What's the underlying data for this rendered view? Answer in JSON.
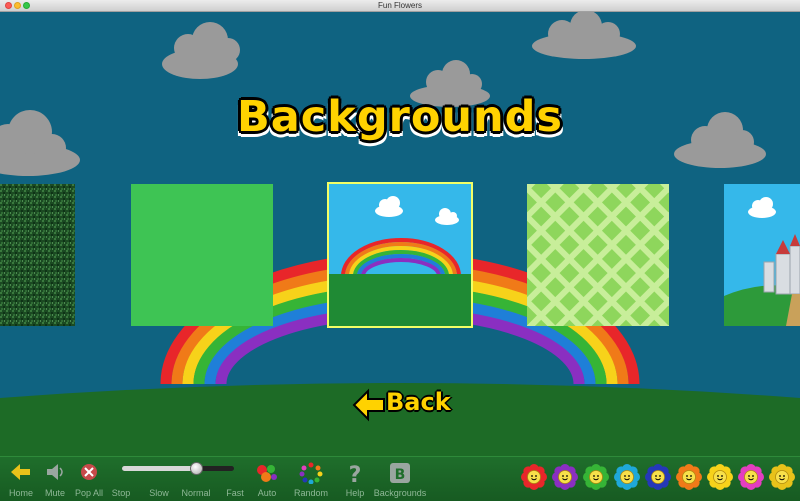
{
  "window": {
    "title": "Fun Flowers"
  },
  "screen": {
    "heading": "Backgrounds",
    "back_label": "Back"
  },
  "backgrounds": [
    {
      "name": "grass-texture",
      "selected": false
    },
    {
      "name": "plain-green",
      "selected": false
    },
    {
      "name": "rainbow",
      "selected": true
    },
    {
      "name": "green-checkered",
      "selected": false
    },
    {
      "name": "castle",
      "selected": false
    }
  ],
  "toolbar": {
    "home": "Home",
    "mute": "Mute",
    "pop_all": "Pop All",
    "stop": "Stop",
    "slow": "Slow",
    "normal": "Normal",
    "fast": "Fast",
    "auto": "Auto",
    "random": "Random",
    "help": "Help",
    "backgrounds": "Backgrounds",
    "speed_level": 0.66
  },
  "flower_colors": [
    "#e8262a",
    "#8a2fc1",
    "#36b436",
    "#1fa8d8",
    "#2538b8",
    "#f07a18",
    "#f7d21a",
    "#e43ec0",
    "#e8c21a"
  ],
  "colors": {
    "sky": "#0f6381",
    "grass": "#1d6b26",
    "title_yellow": "#ffd200",
    "selected_outline": "#f3ff66"
  }
}
